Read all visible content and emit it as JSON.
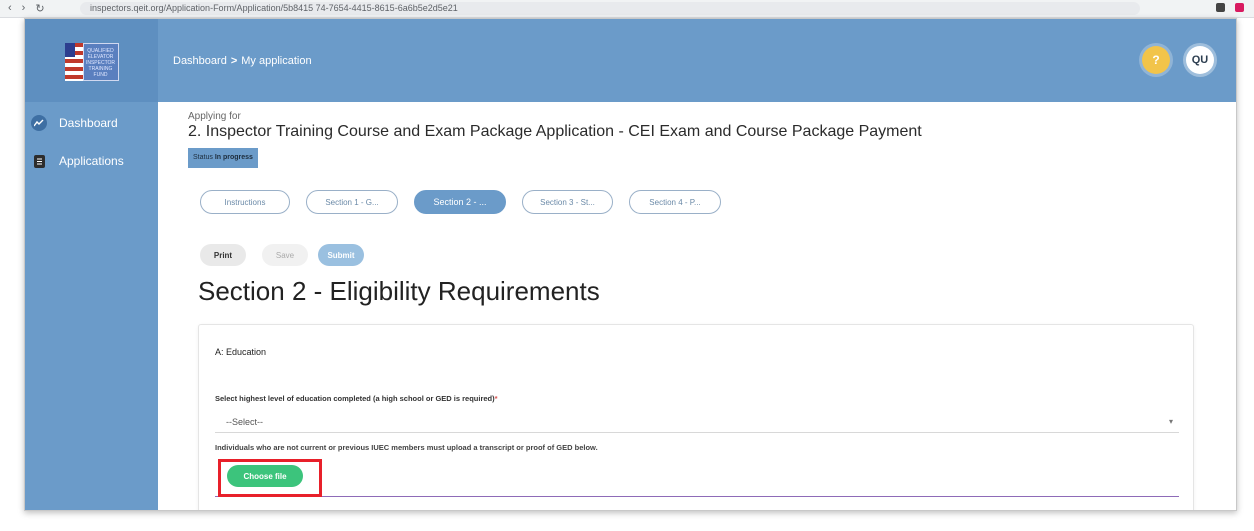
{
  "browser": {
    "url": "inspectors.qeit.org/Application-Form/Application/5b8415 74-7654-4415-8615-6a6b5e2d5e21",
    "nav_back": "‹",
    "nav_forward": "›",
    "nav_reload": "↻"
  },
  "header": {
    "logo_text": "QUALIFIED ELEVATOR INSPECTOR TRAINING FUND",
    "breadcrumb_home": "Dashboard",
    "breadcrumb_separator": ">",
    "breadcrumb_current": "My application",
    "help_icon": "?",
    "avatar_initials": "QU"
  },
  "sidebar": {
    "items": [
      {
        "label": "Dashboard",
        "icon": "trend-icon"
      },
      {
        "label": "Applications",
        "icon": "document-icon"
      }
    ]
  },
  "application": {
    "applying_for_label": "Applying for",
    "title": "2. Inspector Training Course and Exam Package Application - CEI Exam and Course Package Payment",
    "status_label": "Status",
    "status_value": "In progress"
  },
  "tabs": [
    {
      "label": "Instructions",
      "active": false
    },
    {
      "label": "Section 1 - G...",
      "active": false
    },
    {
      "label": "Section 2 - ...",
      "active": true
    },
    {
      "label": "Section 3 - St...",
      "active": false
    },
    {
      "label": "Section 4 - P...",
      "active": false
    }
  ],
  "actions": {
    "print": "Print",
    "save": "Save",
    "submit": "Submit"
  },
  "section": {
    "heading": "Section 2 - Eligibility Requirements",
    "card_title": "A: Education",
    "question_label": "Select highest level of education completed (a high school or GED is required)",
    "required_marker": "*",
    "select_value": "--Select--",
    "select_chevron": "▾",
    "note": "Individuals who are not current or previous IUEC members must upload a transcript or proof of GED below.",
    "choose_file": "Choose file"
  },
  "colors": {
    "header_blue": "#6b9bc9",
    "choose_green": "#3cc47c",
    "highlight_red": "#e8202a",
    "file_underline": "#8e6bb8"
  }
}
